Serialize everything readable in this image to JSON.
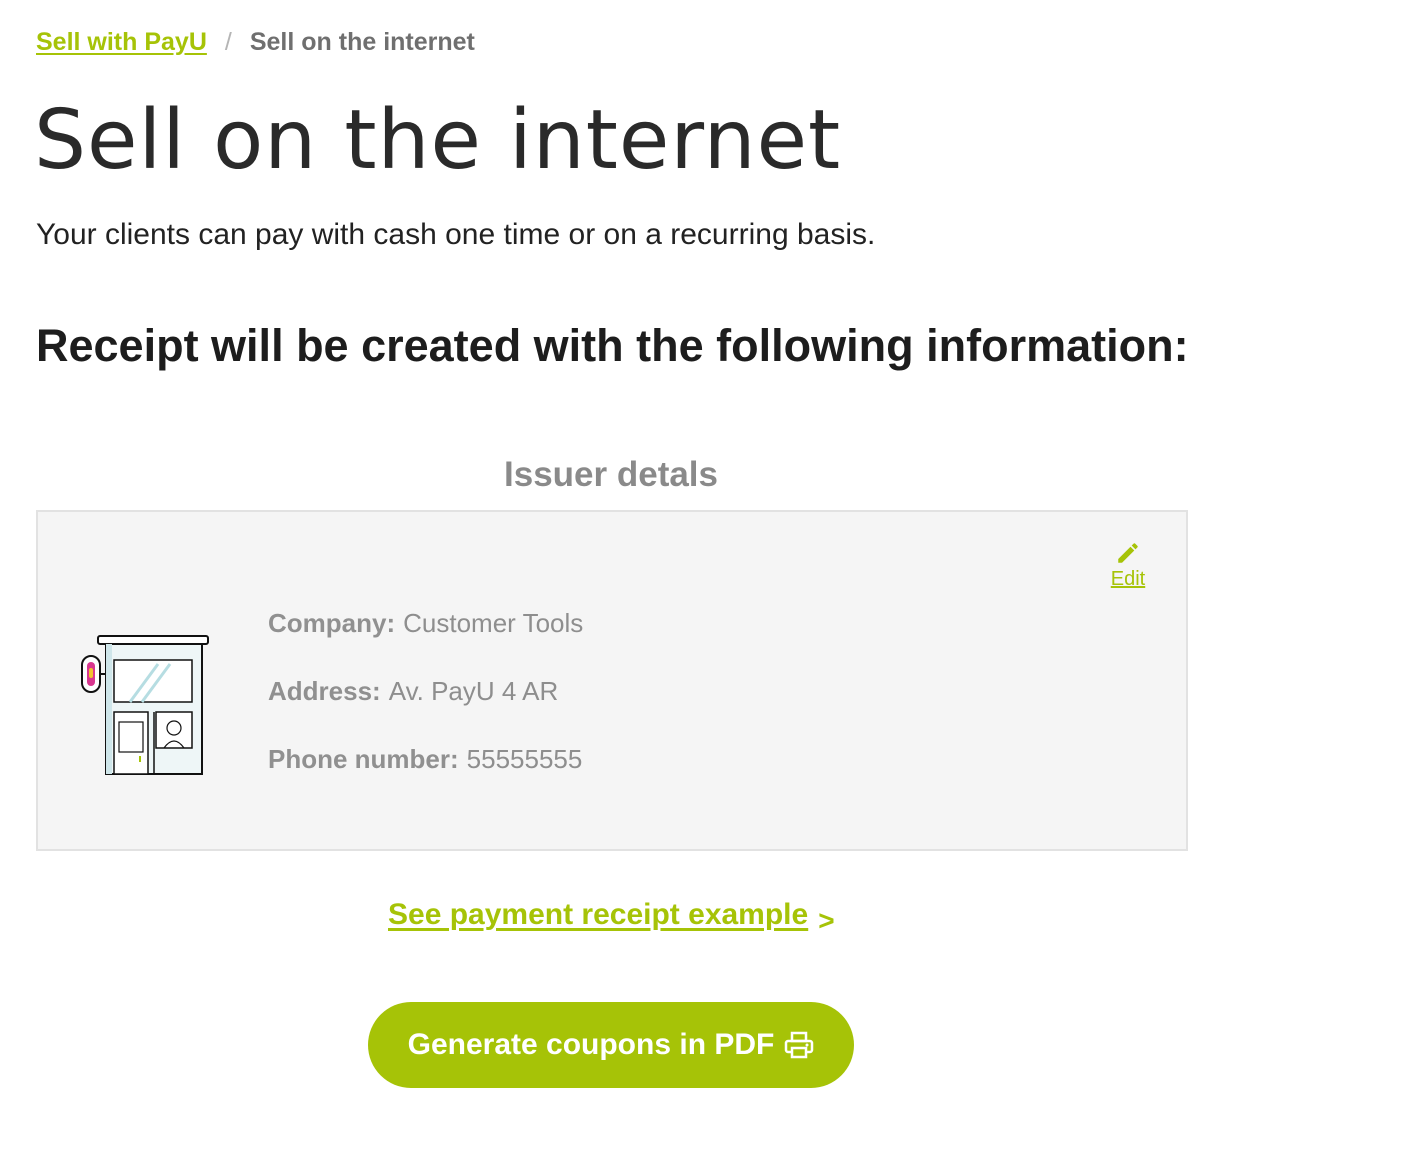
{
  "breadcrumb": {
    "parent_label": "Sell with PayU",
    "separator": "/",
    "current_label": "Sell on the internet"
  },
  "page": {
    "title": "Sell on the internet",
    "subtitle": "Your clients can pay with cash one time or on a recurring basis.",
    "section_title": "Receipt will be created with the following information:"
  },
  "issuer": {
    "heading": "Issuer detals",
    "edit_label": "Edit",
    "edit_icon": "pencil-icon",
    "illustration": "store-kiosk-illustration",
    "company_label": "Company:",
    "company_value": "Customer Tools",
    "address_label": "Address:",
    "address_value": "Av. PayU 4 AR",
    "phone_label": "Phone number:",
    "phone_value": "55555555"
  },
  "receipt_link": {
    "label": "See payment receipt example",
    "arrow": ">"
  },
  "generate_button": {
    "label": "Generate coupons in PDF",
    "icon": "printer-icon"
  },
  "colors": {
    "accent": "#a6c307",
    "card_background": "#f5f5f5",
    "muted_text": "#8e8e8e"
  }
}
